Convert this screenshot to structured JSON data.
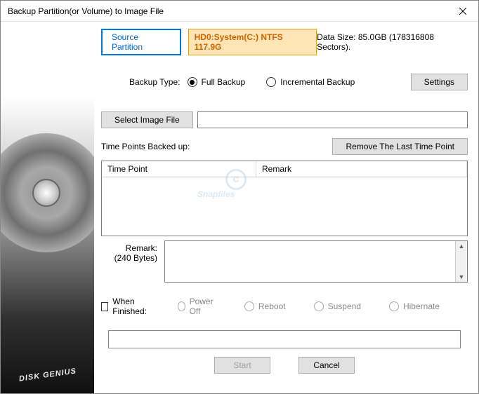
{
  "window": {
    "title": "Backup Partition(or Volume) to Image File"
  },
  "sidebar": {
    "brand": "DISK GENIUS"
  },
  "tabs": {
    "source_partition": "Source Partition"
  },
  "partition_info": "HD0:System(C:) NTFS 117.9G",
  "data_size": "Data Size: 85.0GB (178316808 Sectors).",
  "backup_type": {
    "label": "Backup Type:",
    "full": "Full Backup",
    "incremental": "Incremental Backup"
  },
  "buttons": {
    "settings": "Settings",
    "select_image": "Select Image File",
    "remove_timepoint": "Remove The Last Time Point",
    "start": "Start",
    "cancel": "Cancel"
  },
  "timepoints": {
    "label": "Time Points Backed up:",
    "col_timepoint": "Time Point",
    "col_remark": "Remark"
  },
  "remark": {
    "label": "Remark:",
    "bytes": "(240 Bytes)"
  },
  "finished": {
    "label": "When Finished:",
    "poweroff": "Power Off",
    "reboot": "Reboot",
    "suspend": "Suspend",
    "hibernate": "Hibernate"
  },
  "watermark": "Snapfiles"
}
